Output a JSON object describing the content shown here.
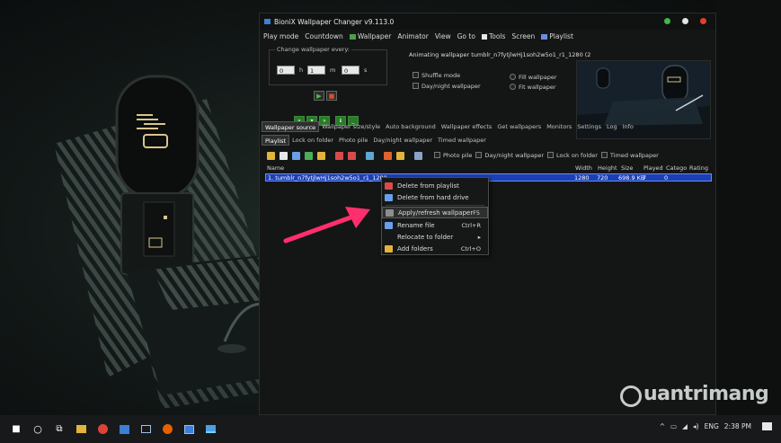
{
  "window": {
    "title": "BioniX Wallpaper Changer v9.113.0"
  },
  "menu": {
    "items": [
      "Play mode",
      "Countdown",
      "Wallpaper",
      "Animator",
      "View",
      "Go to",
      "Tools",
      "Screen",
      "Playlist"
    ]
  },
  "timer": {
    "legend": "Change wallpaper every:",
    "hours_value": "0",
    "hours_unit": "h",
    "minutes_value": "1",
    "minutes_unit": "m",
    "seconds_value": "0",
    "seconds_unit": "s"
  },
  "status": {
    "animating_text": "Animating wallpaper tumblr_n7fytjlwHj1soh2w5o1_r1_1280  (2"
  },
  "options": {
    "shuffle_mode": "Shuffle mode",
    "daynight_wallpaper": "Day/night wallpaper",
    "fill_wallpaper": "Fill wallpaper",
    "fit_wallpaper": "Fit wallpaper"
  },
  "tabs_main": [
    "Wallpaper source",
    "Wallpaper size/style",
    "Auto background",
    "Wallpaper effects",
    "Get wallpapers",
    "Monitors",
    "Settings",
    "Log",
    "Info"
  ],
  "tabs_sub": [
    "Playlist",
    "Lock on folder",
    "Photo pile",
    "Day/night wallpaper",
    "Timed wallpaper"
  ],
  "toolbar": {
    "photo_pile": "Photo pile",
    "daynight_wallpaper": "Day/night wallpaper",
    "lock_on_folder": "Lock on folder",
    "timed_wallpaper": "Timed wallpaper"
  },
  "playlist": {
    "columns": [
      "Name",
      "Width",
      "Height",
      "Size",
      "Played",
      "Catego",
      "Rating"
    ],
    "rows": [
      {
        "name": "1. tumblr_n7fytjlwHj1soh2w5o1_r1_1280",
        "width": "1280",
        "height": "720",
        "size": "698.9 KB",
        "played": "7",
        "category": "0",
        "rating": ""
      }
    ]
  },
  "context_menu": {
    "items": [
      {
        "label": "Delete from playlist",
        "shortcut": ""
      },
      {
        "label": "Delete from hard drive",
        "shortcut": ""
      },
      {
        "label": "Apply/refresh wallpaper",
        "shortcut": "F5"
      },
      {
        "label": "Rename file",
        "shortcut": "Ctrl+R"
      },
      {
        "label": "Relocate to folder",
        "shortcut": "▸"
      },
      {
        "label": "Add folders",
        "shortcut": "Ctrl+O"
      }
    ]
  },
  "taskbar": {
    "language": "ENG",
    "time": "2:38 PM"
  },
  "watermark": {
    "text": "uantrimang"
  },
  "colors": {
    "selection_row": "#1b3fb5",
    "arrow": "#ff2f6d",
    "play_green": "#4dc24d",
    "stop_red": "#d84e2f"
  }
}
